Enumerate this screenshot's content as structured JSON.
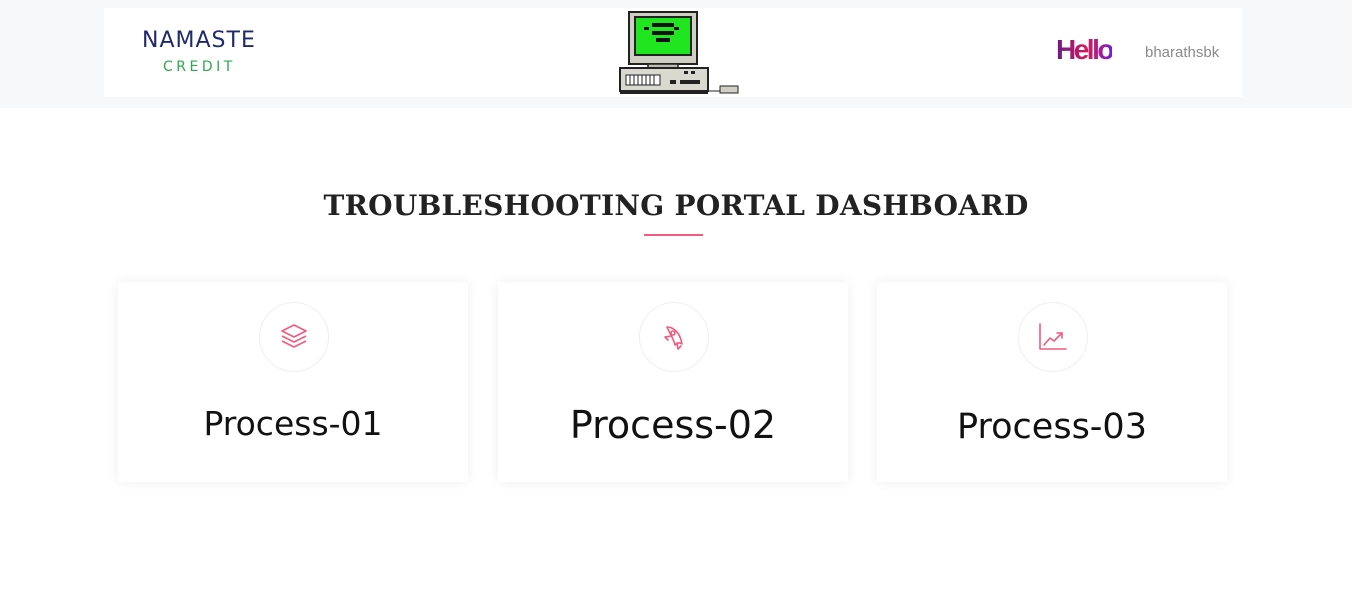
{
  "header": {
    "logo_line1": "NAMASTE",
    "logo_line2": "CREDIT",
    "greeting": "Hello",
    "username": "bharathsbk"
  },
  "main": {
    "title": "TROUBLESHOOTING PORTAL DASHBOARD",
    "cards": [
      {
        "label": "Process-01",
        "icon": "layers-icon"
      },
      {
        "label": "Process-02",
        "icon": "rocket-icon"
      },
      {
        "label": "Process-03",
        "icon": "chart-trend-icon"
      }
    ]
  },
  "colors": {
    "accent": "#f25a7e",
    "logo_navy": "#1e2a6b",
    "logo_green": "#2fa84f",
    "screen_green": "#22ee22"
  }
}
